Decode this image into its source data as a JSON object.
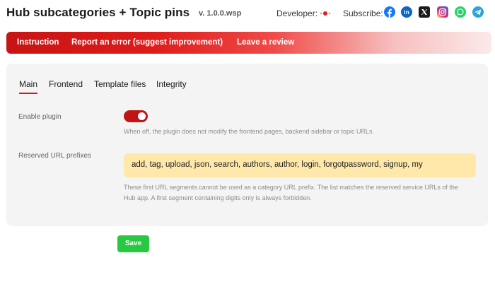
{
  "header": {
    "title": "Hub subcategories + Topic pins",
    "version": "v. 1.0.0.wsp",
    "developer_label": "Developer:",
    "subscribe_label": "Subscribe:",
    "social": [
      {
        "name": "facebook",
        "color": "#1877f2"
      },
      {
        "name": "linkedin",
        "color": "#0a66c2"
      },
      {
        "name": "x",
        "color": "#1b1b1b"
      },
      {
        "name": "instagram",
        "color": "#d62976"
      },
      {
        "name": "whatsapp",
        "color": "#25d366"
      },
      {
        "name": "telegram",
        "color": "#2aa3df"
      }
    ]
  },
  "banner": {
    "links": [
      "Instruction",
      "Report an error (suggest improvement)",
      "Leave a review"
    ]
  },
  "tabs": [
    {
      "label": "Main",
      "active": true
    },
    {
      "label": "Frontend",
      "active": false
    },
    {
      "label": "Template files",
      "active": false
    },
    {
      "label": "Integrity",
      "active": false
    }
  ],
  "settings": {
    "enable_plugin": {
      "label": "Enable plugin",
      "enabled": true,
      "hint": "When off, the plugin does not modify the frontend pages, backend sidebar or topic URLs."
    },
    "reserved_prefixes": {
      "label": "Reserved URL prefixes",
      "value": "add, tag, upload, json, search, authors, author, login, forgotpassword, signup, my",
      "hint_line1": "These first URL segments cannot be used as a category URL prefix. The list matches the reserved service URLs of the",
      "hint_line2": "Hub app. A first segment containing digits only is always forbidden."
    }
  },
  "actions": {
    "save_label": "Save"
  },
  "colors": {
    "accent": "#d21b1b",
    "save": "#28c940",
    "input_highlight": "#ffe8a9"
  }
}
